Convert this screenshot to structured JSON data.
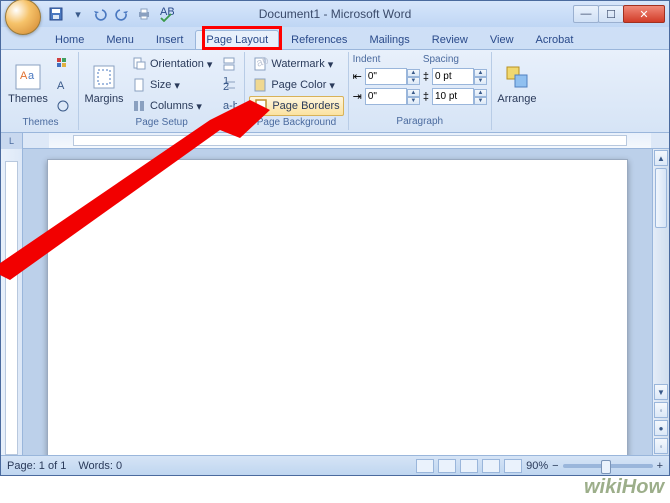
{
  "title": "Document1 - Microsoft Word",
  "tabs": [
    "Home",
    "Menu",
    "Insert",
    "Page Layout",
    "References",
    "Mailings",
    "Review",
    "View",
    "Acrobat"
  ],
  "activeTab": "Page Layout",
  "ribbon": {
    "themes": {
      "label": "Themes",
      "main": "Themes"
    },
    "pageSetup": {
      "label": "Page Setup",
      "margins": "Margins",
      "orientation": "Orientation",
      "size": "Size",
      "columns": "Columns"
    },
    "pageBackground": {
      "label": "Page Background",
      "watermark": "Watermark",
      "pageColor": "Page Color",
      "pageBorders": "Page Borders"
    },
    "paragraph": {
      "label": "Paragraph",
      "indent": "Indent",
      "spacing": "Spacing",
      "indentLeft": "0\"",
      "indentRight": "0\"",
      "spacingBefore": "0 pt",
      "spacingAfter": "10 pt"
    },
    "arrange": {
      "label": "",
      "main": "Arrange"
    }
  },
  "status": {
    "page": "Page: 1 of 1",
    "words": "Words: 0",
    "zoom": "90%"
  },
  "watermark": "wikiHow",
  "rulerCorner": "L"
}
